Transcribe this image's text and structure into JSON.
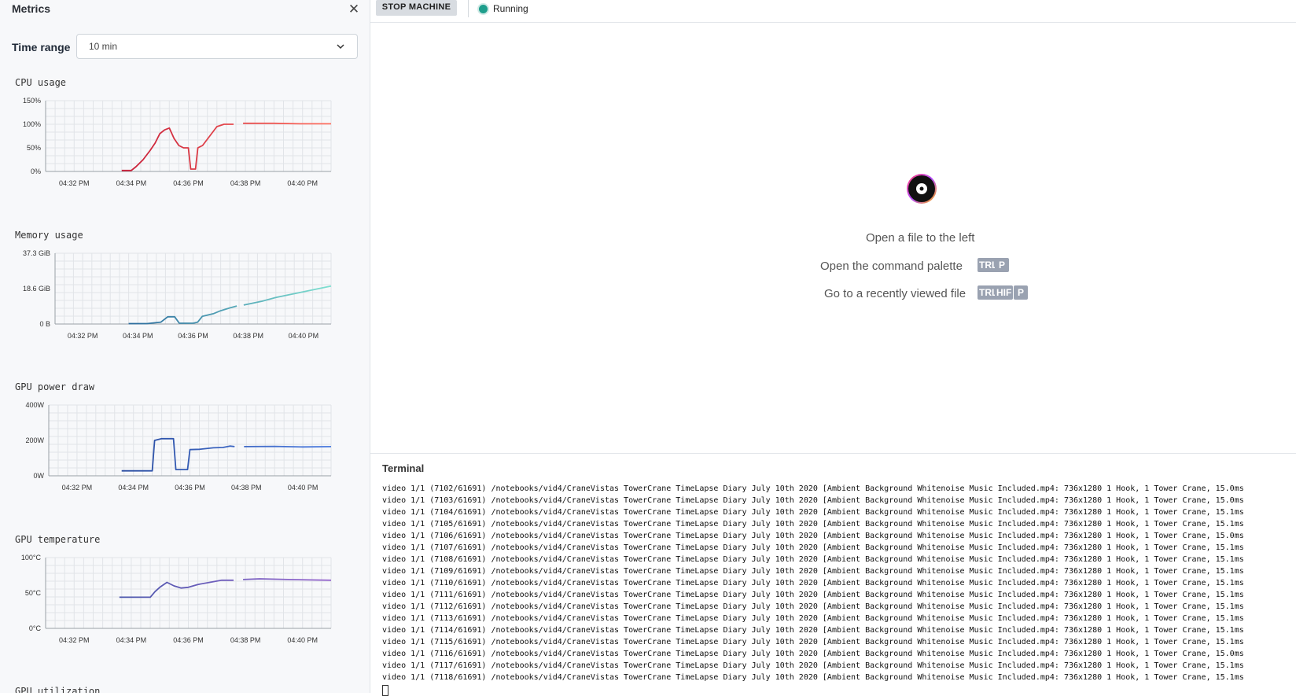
{
  "sidebar": {
    "title": "Metrics",
    "close_icon": "close-icon",
    "time_range": {
      "label": "Time range",
      "value": "10 min"
    },
    "charts": [
      {
        "title": "CPU usage",
        "type": "line",
        "color_start": "#b3002a",
        "color_end": "#ff7060",
        "x_ticks": [
          "04:32 PM",
          "04:34 PM",
          "04:36 PM",
          "04:38 PM",
          "04:40 PM"
        ],
        "y_ticks": [
          "150%",
          "100%",
          "50%",
          "0%"
        ],
        "ylim": [
          0,
          150
        ],
        "x_range": [
          "04:31 PM",
          "04:41 PM"
        ],
        "points": [
          [
            "04:33:40",
            2
          ],
          [
            "04:34:00",
            2
          ],
          [
            "04:34:10",
            10
          ],
          [
            "04:34:25",
            25
          ],
          [
            "04:34:40",
            45
          ],
          [
            "04:34:50",
            60
          ],
          [
            "04:35:00",
            80
          ],
          [
            "04:35:10",
            88
          ],
          [
            "04:35:20",
            92
          ],
          [
            "04:35:30",
            70
          ],
          [
            "04:35:40",
            55
          ],
          [
            "04:35:50",
            50
          ],
          [
            "04:36:00",
            50
          ],
          [
            "04:36:05",
            5
          ],
          [
            "04:36:15",
            5
          ],
          [
            "04:36:20",
            50
          ],
          [
            "04:36:30",
            55
          ],
          [
            "04:36:45",
            75
          ],
          [
            "04:37:00",
            95
          ],
          [
            "04:37:15",
            100
          ],
          [
            "04:37:35",
            100
          ],
          [
            "04:37:45",
            null
          ],
          [
            "04:37:55",
            102
          ],
          [
            "04:39:00",
            102
          ],
          [
            "04:40:00",
            101
          ],
          [
            "04:41:00",
            101
          ]
        ]
      },
      {
        "title": "Memory usage",
        "type": "line",
        "color_start": "#0b3f8a",
        "color_end": "#7fe0d0",
        "x_ticks": [
          "04:32 PM",
          "04:34 PM",
          "04:36 PM",
          "04:38 PM",
          "04:40 PM"
        ],
        "y_ticks": [
          "37.3 GiB",
          "18.6 GiB",
          "0 B"
        ],
        "ylim": [
          0,
          37.3
        ],
        "x_range": [
          "04:31 PM",
          "04:41 PM"
        ],
        "points": [
          [
            "04:33:40",
            0.2
          ],
          [
            "04:34:20",
            0.2
          ],
          [
            "04:34:50",
            1.0
          ],
          [
            "04:35:05",
            3.8
          ],
          [
            "04:35:20",
            3.8
          ],
          [
            "04:35:30",
            0.4
          ],
          [
            "04:36:00",
            0.4
          ],
          [
            "04:36:10",
            1.0
          ],
          [
            "04:36:20",
            4.0
          ],
          [
            "04:36:45",
            5.5
          ],
          [
            "04:37:00",
            7.0
          ],
          [
            "04:37:20",
            8.5
          ],
          [
            "04:37:35",
            9.5
          ],
          [
            "04:37:45",
            null
          ],
          [
            "04:37:50",
            10.0
          ],
          [
            "04:38:30",
            12.0
          ],
          [
            "04:39:00",
            14.0
          ],
          [
            "04:39:30",
            15.5
          ],
          [
            "04:40:00",
            17.0
          ],
          [
            "04:40:30",
            18.5
          ],
          [
            "04:41:00",
            20.0
          ]
        ]
      },
      {
        "title": "GPU power draw",
        "type": "line",
        "color_start": "#1b3a8a",
        "color_end": "#4f7ee0",
        "x_ticks": [
          "04:32 PM",
          "04:34 PM",
          "04:36 PM",
          "04:38 PM",
          "04:40 PM"
        ],
        "y_ticks": [
          "400W",
          "200W",
          "0W"
        ],
        "ylim": [
          0,
          400
        ],
        "x_range": [
          "04:31 PM",
          "04:41 PM"
        ],
        "points": [
          [
            "04:33:35",
            28
          ],
          [
            "04:34:40",
            28
          ],
          [
            "04:34:45",
            200
          ],
          [
            "04:35:00",
            210
          ],
          [
            "04:35:25",
            210
          ],
          [
            "04:35:30",
            35
          ],
          [
            "04:35:55",
            35
          ],
          [
            "04:36:00",
            148
          ],
          [
            "04:36:20",
            150
          ],
          [
            "04:36:50",
            158
          ],
          [
            "04:37:10",
            160
          ],
          [
            "04:37:25",
            168
          ],
          [
            "04:37:35",
            165
          ],
          [
            "04:37:45",
            null
          ],
          [
            "04:37:55",
            165
          ],
          [
            "04:39:00",
            166
          ],
          [
            "04:40:00",
            163
          ],
          [
            "04:41:00",
            165
          ]
        ]
      },
      {
        "title": "GPU temperature",
        "type": "line",
        "color_start": "#2d4e9e",
        "color_end": "#9a6ad0",
        "x_ticks": [
          "04:32 PM",
          "04:34 PM",
          "04:36 PM",
          "04:38 PM",
          "04:40 PM"
        ],
        "y_ticks": [
          "100°C",
          "50°C",
          "0°C"
        ],
        "ylim": [
          0,
          100
        ],
        "x_range": [
          "04:31 PM",
          "04:41 PM"
        ],
        "points": [
          [
            "04:33:35",
            44
          ],
          [
            "04:34:40",
            44
          ],
          [
            "04:34:50",
            52
          ],
          [
            "04:35:00",
            58
          ],
          [
            "04:35:15",
            65
          ],
          [
            "04:35:30",
            60
          ],
          [
            "04:35:45",
            57
          ],
          [
            "04:36:00",
            58
          ],
          [
            "04:36:20",
            62
          ],
          [
            "04:36:45",
            65
          ],
          [
            "04:37:10",
            68
          ],
          [
            "04:37:35",
            68
          ],
          [
            "04:37:45",
            null
          ],
          [
            "04:37:55",
            69
          ],
          [
            "04:38:30",
            70
          ],
          [
            "04:39:30",
            69
          ],
          [
            "04:41:00",
            68
          ]
        ]
      }
    ],
    "next_chart_title": "GPU utilization"
  },
  "toolbar": {
    "stop_label": "STOP MACHINE",
    "status_label": "Running",
    "status_color": "#1e9e8c"
  },
  "welcome": {
    "open_file": "Open a file to the left",
    "command_palette": "Open the command palette",
    "command_keys": [
      "TRL",
      "P"
    ],
    "recent_file": "Go to a recently viewed file",
    "recent_keys": [
      "TRL",
      "HIF",
      "P"
    ]
  },
  "terminal": {
    "title": "Terminal",
    "lines": [
      "video 1/1 (7102/61691) /notebooks/vid4/CraneVistas TowerCrane TimeLapse Diary July 10th 2020 [Ambient Background Whitenoise Music Included.mp4: 736x1280 1 Hook, 1 Tower Crane, 15.0ms",
      "video 1/1 (7103/61691) /notebooks/vid4/CraneVistas TowerCrane TimeLapse Diary July 10th 2020 [Ambient Background Whitenoise Music Included.mp4: 736x1280 1 Hook, 1 Tower Crane, 15.0ms",
      "video 1/1 (7104/61691) /notebooks/vid4/CraneVistas TowerCrane TimeLapse Diary July 10th 2020 [Ambient Background Whitenoise Music Included.mp4: 736x1280 1 Hook, 1 Tower Crane, 15.1ms",
      "video 1/1 (7105/61691) /notebooks/vid4/CraneVistas TowerCrane TimeLapse Diary July 10th 2020 [Ambient Background Whitenoise Music Included.mp4: 736x1280 1 Hook, 1 Tower Crane, 15.1ms",
      "video 1/1 (7106/61691) /notebooks/vid4/CraneVistas TowerCrane TimeLapse Diary July 10th 2020 [Ambient Background Whitenoise Music Included.mp4: 736x1280 1 Hook, 1 Tower Crane, 15.0ms",
      "video 1/1 (7107/61691) /notebooks/vid4/CraneVistas TowerCrane TimeLapse Diary July 10th 2020 [Ambient Background Whitenoise Music Included.mp4: 736x1280 1 Hook, 1 Tower Crane, 15.1ms",
      "video 1/1 (7108/61691) /notebooks/vid4/CraneVistas TowerCrane TimeLapse Diary July 10th 2020 [Ambient Background Whitenoise Music Included.mp4: 736x1280 1 Hook, 1 Tower Crane, 15.1ms",
      "video 1/1 (7109/61691) /notebooks/vid4/CraneVistas TowerCrane TimeLapse Diary July 10th 2020 [Ambient Background Whitenoise Music Included.mp4: 736x1280 1 Hook, 1 Tower Crane, 15.1ms",
      "video 1/1 (7110/61691) /notebooks/vid4/CraneVistas TowerCrane TimeLapse Diary July 10th 2020 [Ambient Background Whitenoise Music Included.mp4: 736x1280 1 Hook, 1 Tower Crane, 15.1ms",
      "video 1/1 (7111/61691) /notebooks/vid4/CraneVistas TowerCrane TimeLapse Diary July 10th 2020 [Ambient Background Whitenoise Music Included.mp4: 736x1280 1 Hook, 1 Tower Crane, 15.1ms",
      "video 1/1 (7112/61691) /notebooks/vid4/CraneVistas TowerCrane TimeLapse Diary July 10th 2020 [Ambient Background Whitenoise Music Included.mp4: 736x1280 1 Hook, 1 Tower Crane, 15.1ms",
      "video 1/1 (7113/61691) /notebooks/vid4/CraneVistas TowerCrane TimeLapse Diary July 10th 2020 [Ambient Background Whitenoise Music Included.mp4: 736x1280 1 Hook, 1 Tower Crane, 15.1ms",
      "video 1/1 (7114/61691) /notebooks/vid4/CraneVistas TowerCrane TimeLapse Diary July 10th 2020 [Ambient Background Whitenoise Music Included.mp4: 736x1280 1 Hook, 1 Tower Crane, 15.1ms",
      "video 1/1 (7115/61691) /notebooks/vid4/CraneVistas TowerCrane TimeLapse Diary July 10th 2020 [Ambient Background Whitenoise Music Included.mp4: 736x1280 1 Hook, 1 Tower Crane, 15.1ms",
      "video 1/1 (7116/61691) /notebooks/vid4/CraneVistas TowerCrane TimeLapse Diary July 10th 2020 [Ambient Background Whitenoise Music Included.mp4: 736x1280 1 Hook, 1 Tower Crane, 15.0ms",
      "video 1/1 (7117/61691) /notebooks/vid4/CraneVistas TowerCrane TimeLapse Diary July 10th 2020 [Ambient Background Whitenoise Music Included.mp4: 736x1280 1 Hook, 1 Tower Crane, 15.1ms",
      "video 1/1 (7118/61691) /notebooks/vid4/CraneVistas TowerCrane TimeLapse Diary July 10th 2020 [Ambient Background Whitenoise Music Included.mp4: 736x1280 1 Hook, 1 Tower Crane, 15.1ms"
    ]
  }
}
